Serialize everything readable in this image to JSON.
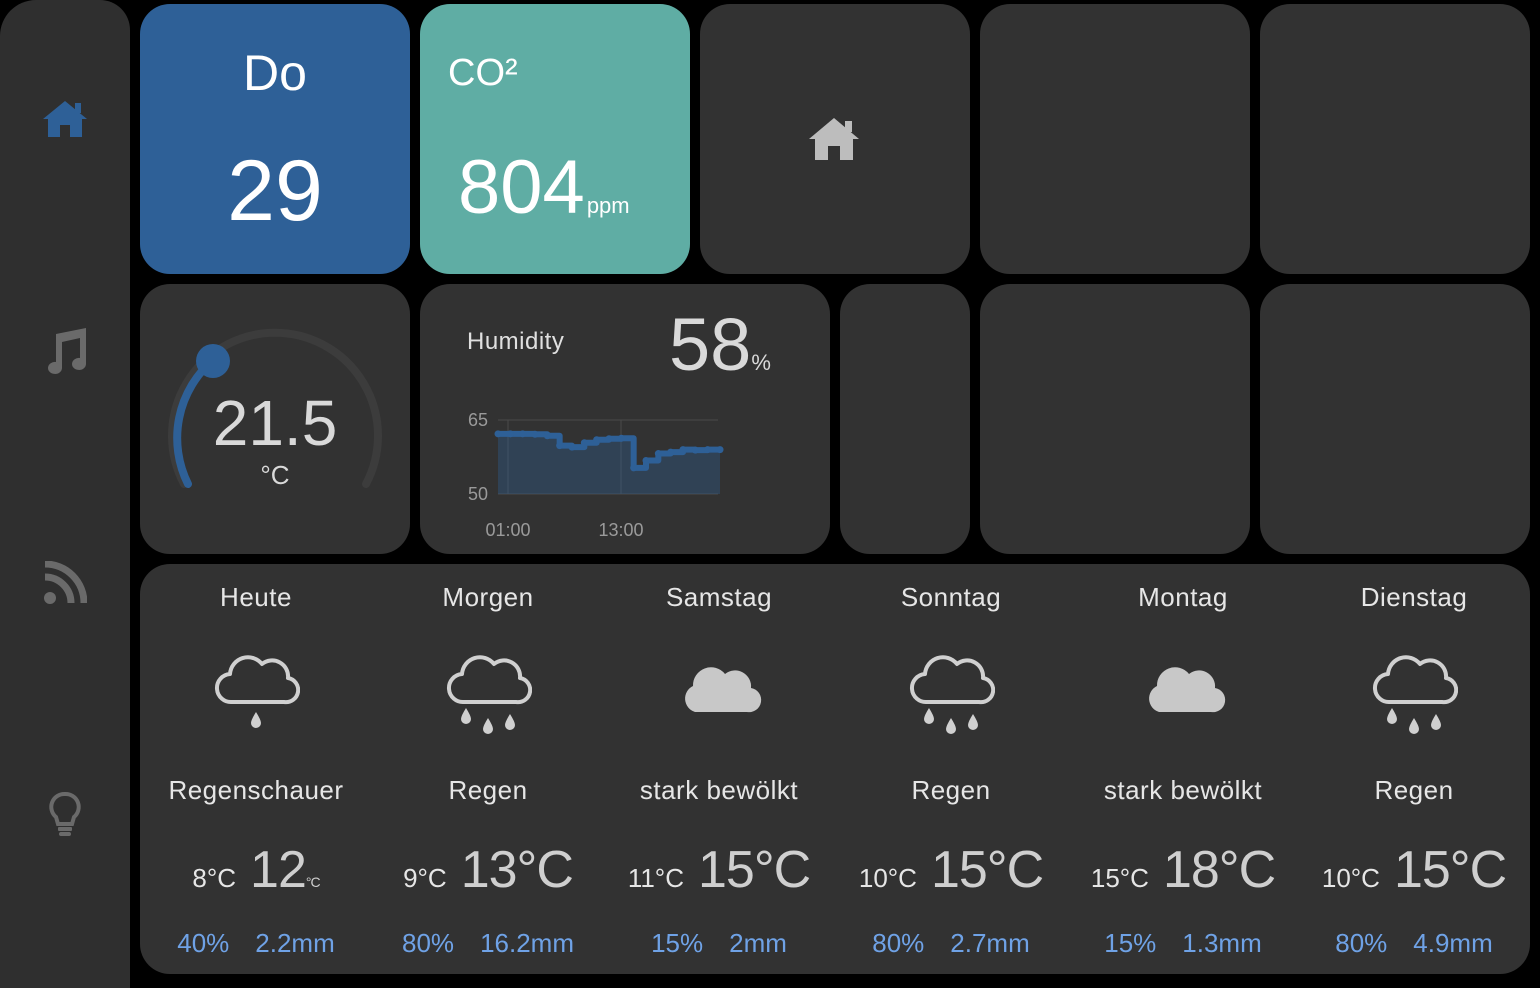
{
  "sidebar": {
    "items": [
      {
        "icon": "home-icon",
        "active": true
      },
      {
        "icon": "music-icon",
        "active": false
      },
      {
        "icon": "rss-icon",
        "active": false
      },
      {
        "icon": "lightbulb-icon",
        "active": false
      }
    ]
  },
  "date_tile": {
    "weekday": "Do",
    "day": "29"
  },
  "co2_tile": {
    "label": "CO²",
    "value": "804",
    "unit": "ppm"
  },
  "thermostat": {
    "value": "21.5",
    "unit": "°C"
  },
  "humidity": {
    "label": "Humidity",
    "value": "58",
    "unit": "%",
    "chart_data": {
      "type": "area",
      "y_ticks": [
        "65",
        "50"
      ],
      "ylim": [
        50,
        65
      ],
      "x_ticks": [
        "01:00",
        "13:00"
      ],
      "x": [
        "01:00",
        "03:00",
        "05:00",
        "07:00",
        "08:00",
        "09:00",
        "10:00",
        "11:00",
        "12:00",
        "13:00",
        "14:00",
        "15:00",
        "16:00",
        "17:00",
        "18:00",
        "19:00",
        "20:00",
        "21:00",
        "22:00"
      ],
      "values": [
        62.2,
        62.2,
        62.2,
        62.1,
        61.8,
        59.8,
        59.5,
        60.4,
        61,
        61.2,
        61.3,
        55.3,
        56.8,
        58.2,
        58.5,
        59,
        58.9,
        59,
        59
      ]
    }
  },
  "colors": {
    "accent": "#2e6097",
    "teal": "#5fada4",
    "link": "#6fa2e6"
  },
  "forecast": [
    {
      "day": "Heute",
      "icon": "rain-showers-icon",
      "desc": "Regenschauer",
      "min": "8°C",
      "max": "12",
      "max_unit": "°C",
      "chance": "40%",
      "amount": "2.2mm"
    },
    {
      "day": "Morgen",
      "icon": "rain-icon",
      "desc": "Regen",
      "min": "9°C",
      "max": "13°C",
      "max_unit": "",
      "chance": "80%",
      "amount": "16.2mm"
    },
    {
      "day": "Samstag",
      "icon": "cloudy-icon",
      "desc": "stark bewölkt",
      "min": "11°C",
      "max": "15°C",
      "max_unit": "",
      "chance": "15%",
      "amount": "2mm"
    },
    {
      "day": "Sonntag",
      "icon": "rain-icon",
      "desc": "Regen",
      "min": "10°C",
      "max": "15°C",
      "max_unit": "",
      "chance": "80%",
      "amount": "2.7mm"
    },
    {
      "day": "Montag",
      "icon": "cloudy-icon",
      "desc": "stark bewölkt",
      "min": "15°C",
      "max": "18°C",
      "max_unit": "",
      "chance": "15%",
      "amount": "1.3mm"
    },
    {
      "day": "Dienstag",
      "icon": "rain-icon",
      "desc": "Regen",
      "min": "10°C",
      "max": "15°C",
      "max_unit": "",
      "chance": "80%",
      "amount": "4.9mm"
    }
  ]
}
